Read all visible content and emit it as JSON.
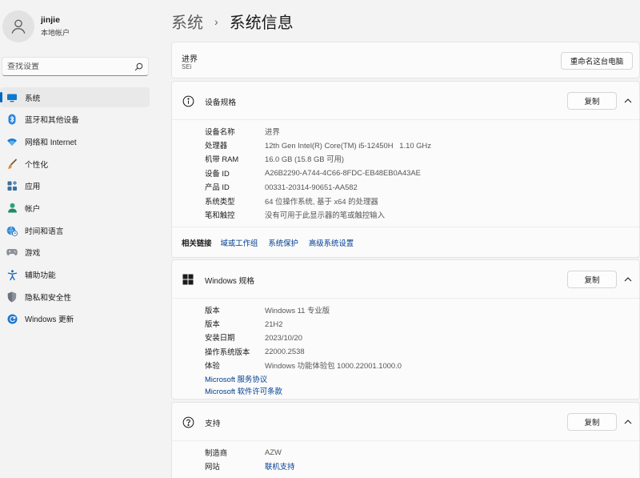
{
  "user": {
    "name": "jinjie",
    "account_type": "本地帐户"
  },
  "search": {
    "placeholder": "查找设置"
  },
  "nav": [
    {
      "label": "系统",
      "icon": "monitor-icon",
      "active": true
    },
    {
      "label": "蓝牙和其他设备",
      "icon": "bluetooth-icon"
    },
    {
      "label": "网络和 Internet",
      "icon": "wifi-icon"
    },
    {
      "label": "个性化",
      "icon": "brush-icon"
    },
    {
      "label": "应用",
      "icon": "apps-icon"
    },
    {
      "label": "帐户",
      "icon": "person-icon"
    },
    {
      "label": "时间和语言",
      "icon": "globe-clock-icon"
    },
    {
      "label": "游戏",
      "icon": "gamepad-icon"
    },
    {
      "label": "辅助功能",
      "icon": "accessibility-icon"
    },
    {
      "label": "隐私和安全性",
      "icon": "shield-icon"
    },
    {
      "label": "Windows 更新",
      "icon": "update-icon"
    }
  ],
  "breadcrumb": {
    "parent": "系统",
    "separator": "›",
    "current": "系统信息"
  },
  "device": {
    "name": "进界",
    "model": "SEi",
    "rename_label": "重命名这台电脑"
  },
  "device_specs": {
    "title": "设备规格",
    "copy_label": "复制",
    "rows": [
      {
        "key": "设备名称",
        "value": "进界"
      },
      {
        "key": "处理器",
        "value": "12th Gen Intel(R) Core(TM) i5-12450H   1.10 GHz"
      },
      {
        "key": "机带 RAM",
        "value": "16.0 GB (15.8 GB 可用)"
      },
      {
        "key": "设备 ID",
        "value": "A26B2290-A744-4C66-8FDC-EB48EB0A43AE"
      },
      {
        "key": "产品 ID",
        "value": "00331-20314-90651-AA582"
      },
      {
        "key": "系统类型",
        "value": "64 位操作系统, 基于 x64 的处理器"
      },
      {
        "key": "笔和触控",
        "value": "没有可用于此显示器的笔或触控输入"
      }
    ],
    "related_label": "相关链接",
    "related_links": [
      "域或工作组",
      "系统保护",
      "高级系统设置"
    ]
  },
  "windows_specs": {
    "title": "Windows 规格",
    "copy_label": "复制",
    "rows": [
      {
        "key": "版本",
        "value": "Windows 11 专业版"
      },
      {
        "key": "版本",
        "value": "21H2"
      },
      {
        "key": "安装日期",
        "value": "2023/10/20"
      },
      {
        "key": "操作系统版本",
        "value": "22000.2538"
      },
      {
        "key": "体验",
        "value": "Windows 功能体验包 1000.22001.1000.0"
      }
    ],
    "links": [
      "Microsoft 服务协议",
      "Microsoft 软件许可条款"
    ]
  },
  "support": {
    "title": "支持",
    "copy_label": "复制",
    "rows": [
      {
        "key": "制造商",
        "value": "AZW",
        "is_link": false
      },
      {
        "key": "网站",
        "value": "联机支持",
        "is_link": true
      }
    ]
  },
  "colors": {
    "accent": "#0067c0",
    "link": "#003e92",
    "background": "#f3f3f3",
    "card": "#fbfbfb"
  }
}
